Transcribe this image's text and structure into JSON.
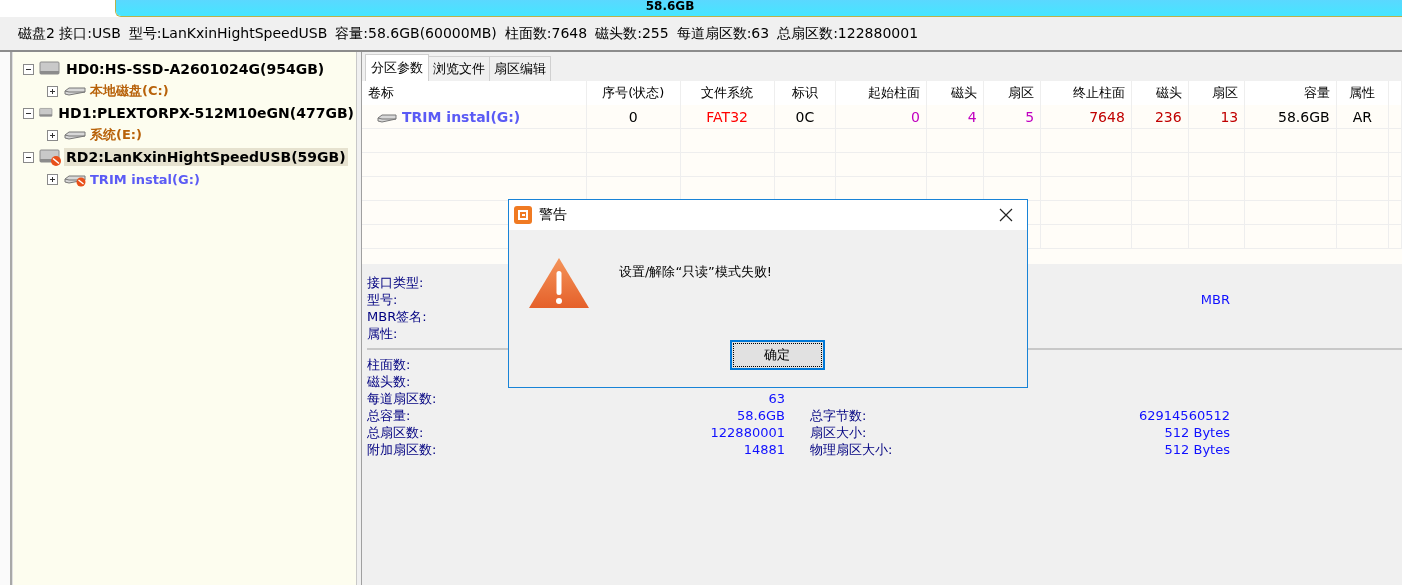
{
  "capacity_bar": {
    "text": "58.6GB",
    "level": 1
  },
  "disk_info": [
    "磁盘2 接口:USB",
    "型号:LanKxinHightSpeedUSB",
    "容量:58.6GB(60000MB)",
    "柱面数:7648",
    "磁头数:255",
    "每道扇区数:63",
    "总扇区数:122880001"
  ],
  "tree": [
    {
      "label": "HD0:HS-SSD-A2601024G(954GB)",
      "expanded": true,
      "selected": false,
      "removable": false,
      "children": [
        {
          "label": "本地磁盘(C:)",
          "expanded": false,
          "removable": false,
          "color": "#b8620a"
        }
      ]
    },
    {
      "label": "HD1:PLEXTORPX-512M10eGN(477GB)",
      "expanded": true,
      "selected": false,
      "removable": false,
      "children": [
        {
          "label": "系统(E:)",
          "expanded": false,
          "removable": false,
          "color": "#b8620a"
        }
      ]
    },
    {
      "label": "RD2:LanKxinHightSpeedUSB(59GB)",
      "expanded": true,
      "selected": true,
      "removable": true,
      "children": [
        {
          "label": "TRIM instal(G:)",
          "expanded": false,
          "removable": true,
          "color": "#5b5bf5"
        }
      ]
    }
  ],
  "tabs": [
    {
      "label": "分区参数",
      "selected": true
    },
    {
      "label": "浏览文件",
      "selected": false
    },
    {
      "label": "扇区编辑",
      "selected": false
    }
  ],
  "table": {
    "columns": [
      {
        "label": "卷标",
        "color": "#5b5bf5"
      },
      {
        "label": "序号(状态)",
        "color": "#000000"
      },
      {
        "label": "文件系统",
        "color": "#ff0000"
      },
      {
        "label": "标识",
        "color": "#000000"
      },
      {
        "label": "起始柱面",
        "color": "#c000c0"
      },
      {
        "label": "磁头",
        "color": "#c000c0"
      },
      {
        "label": "扇区",
        "color": "#c000c0"
      },
      {
        "label": "终止柱面",
        "color": "#c00000"
      },
      {
        "label": "磁头",
        "color": "#c00000"
      },
      {
        "label": "扇区",
        "color": "#c00000"
      },
      {
        "label": "容量",
        "color": "#000000"
      },
      {
        "label": "属性",
        "color": "#000000"
      }
    ],
    "rows": [
      {
        "selected": false,
        "cells": [
          "TRIM instal(G:)",
          "0",
          "FAT32",
          "0C",
          "0",
          "4",
          "5",
          "7648",
          "236",
          "13",
          "58.6GB",
          "AR"
        ]
      }
    ]
  },
  "details": [
    {
      "rows": [
        {
          "label": "接口类型:"
        },
        {
          "label": "型号:",
          "value_2": "MBR"
        },
        {
          "label": "MBR签名:"
        },
        {
          "label": "属性:"
        }
      ]
    },
    {
      "rows": [
        {
          "label": "柱面数:"
        },
        {
          "label": "磁头数:"
        },
        {
          "label": "每道扇区数:",
          "value": "63"
        },
        {
          "label": "总容量:",
          "value": "58.6GB",
          "label_2": "总字节数:",
          "value_2": "62914560512"
        },
        {
          "label": "总扇区数:",
          "value": "122880001",
          "label_2": "扇区大小:",
          "value_2": "512 Bytes"
        },
        {
          "label": "附加扇区数:",
          "value": "14881",
          "label_2": "物理扇区大小:",
          "value_2": "512 Bytes"
        }
      ]
    }
  ],
  "dialog": {
    "title": "警告",
    "message": "设置/解除“只读”模式失败!",
    "buttons": [
      {
        "label": "确定",
        "selected": true
      }
    ]
  }
}
